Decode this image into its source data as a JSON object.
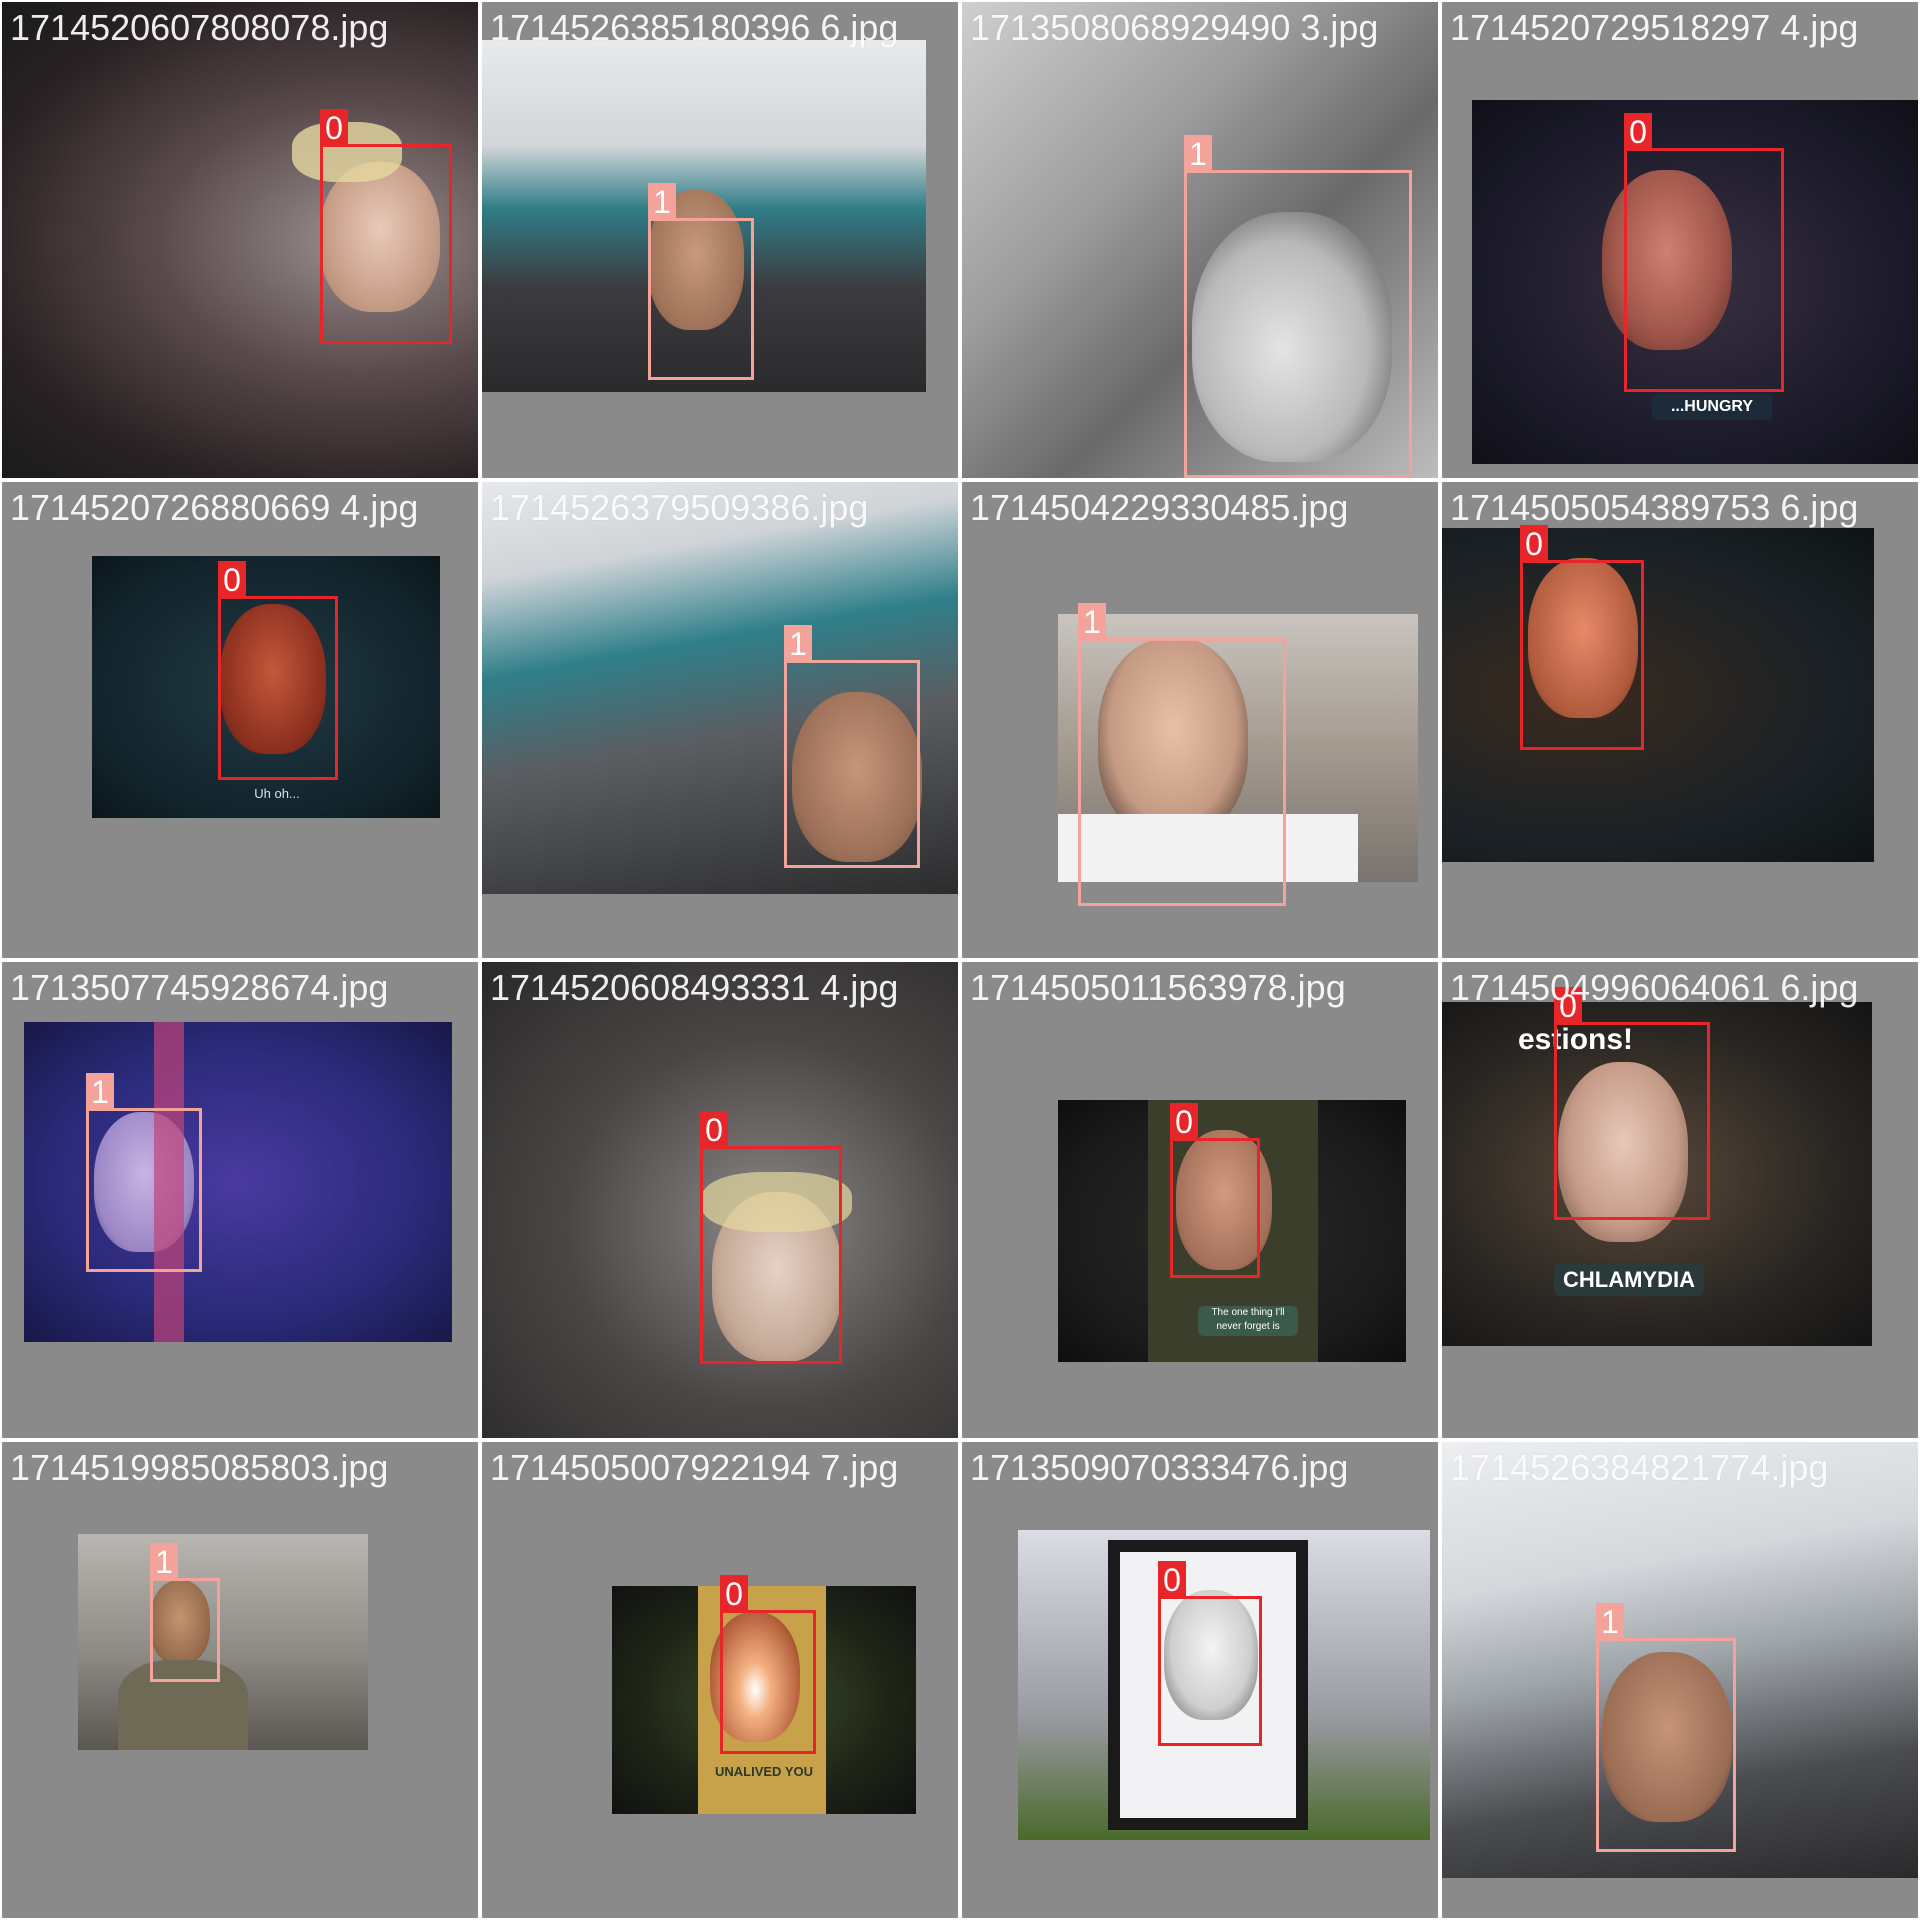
{
  "grid": {
    "tiles": [
      {
        "filename": "1714520607808078.jpg",
        "box_label": "0"
      },
      {
        "filename": "1714526385180396 6.jpg",
        "box_label": "1"
      },
      {
        "filename": "1713508068929490 3.jpg",
        "box_label": "1"
      },
      {
        "filename": "1714520729518297 4.jpg",
        "box_label": "0"
      },
      {
        "filename": "1714520726880669 4.jpg",
        "box_label": "0"
      },
      {
        "filename": "1714526379509386.jpg",
        "box_label": "1"
      },
      {
        "filename": "1714504229330485.jpg",
        "box_label": "1"
      },
      {
        "filename": "1714505054389753 6.jpg",
        "box_label": "0"
      },
      {
        "filename": "1713507745928674.jpg",
        "box_label": "1"
      },
      {
        "filename": "1714520608493331 4.jpg",
        "box_label": "0"
      },
      {
        "filename": "1714505011563978.jpg",
        "box_label": "0"
      },
      {
        "filename": "1714504996064061 6.jpg",
        "box_label": "0"
      },
      {
        "filename": "1714519985085803.jpg",
        "box_label": "1"
      },
      {
        "filename": "1714505007922194 7.jpg",
        "box_label": "0"
      },
      {
        "filename": "1713509070333476.jpg",
        "box_label": "0"
      },
      {
        "filename": "1714526384821774.jpg",
        "box_label": "1"
      }
    ]
  },
  "captions": {
    "hungry": "...HUNGRY",
    "uh_oh": "Uh oh...",
    "chlamydia": "CHLAMYDIA",
    "unalived": "UNALIVED YOU",
    "questions": "estions!",
    "never_forget": "The one thing I'll never forget is"
  },
  "colors": {
    "class0_box": "#e8262a",
    "class1_box": "#f4a39a",
    "tile_background": "#8a8a8a"
  }
}
